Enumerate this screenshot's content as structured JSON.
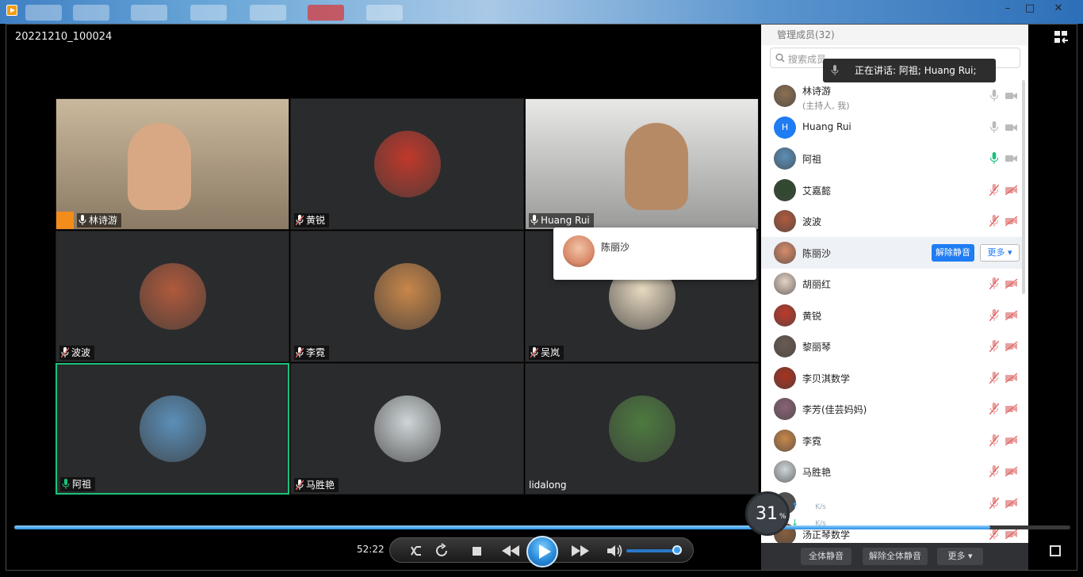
{
  "window": {
    "title": "20221210_100024",
    "controls": [
      "–",
      "□",
      "✕"
    ]
  },
  "video_tiles": [
    {
      "name": "林诗游",
      "mic": "on",
      "host": true,
      "avatar_color": "#8c6f52"
    },
    {
      "name": "黄锐",
      "mic": "muted",
      "host": false,
      "avatar_color": "#c0392b"
    },
    {
      "name": "Huang Rui",
      "mic": "on",
      "host": false,
      "avatar_color": "#6d6a66"
    },
    {
      "name": "波波",
      "mic": "muted",
      "host": false,
      "avatar_color": "#b05a3c"
    },
    {
      "name": "李霓",
      "mic": "muted",
      "host": false,
      "avatar_color": "#c9874a"
    },
    {
      "name": "吴岚",
      "mic": "muted",
      "host": false,
      "avatar_color": "#e7d9c0"
    },
    {
      "name": "阿祖",
      "mic": "speaking",
      "host": false,
      "avatar_color": "#5b8fb8",
      "active": true
    },
    {
      "name": "马胜艳",
      "mic": "muted",
      "host": false,
      "avatar_color": "#cfd6d8"
    },
    {
      "name": "lidalong",
      "mic": "none",
      "host": false,
      "avatar_color": "#4d7a3f"
    }
  ],
  "popup": {
    "name": "陈丽沙"
  },
  "panel": {
    "title": "管理成员(32)",
    "search_placeholder": "搜索成员",
    "speaking_label": "正在讲话: 阿祖; Huang Rui;",
    "unmute_label": "解除静音",
    "more_label": "更多 ▾",
    "members": [
      {
        "name": "林诗游",
        "sub": "(主持人, 我)",
        "mic": "on",
        "avatar_color": "#8c6f52"
      },
      {
        "name": "Huang Rui",
        "mic": "on",
        "avatar_color": "#1f7cf2",
        "initial": "H"
      },
      {
        "name": "阿祖",
        "mic": "speaking",
        "avatar_color": "#5b8fb8"
      },
      {
        "name": "艾嘉懿",
        "mic": "muted",
        "avatar_color": "#2e4a2c"
      },
      {
        "name": "波波",
        "mic": "muted",
        "avatar_color": "#b05a3c"
      },
      {
        "name": "陈丽沙",
        "mic": "muted",
        "avatar_color": "#d98b6a",
        "highlight": true
      },
      {
        "name": "胡丽红",
        "mic": "muted",
        "avatar_color": "#e5d2c4"
      },
      {
        "name": "黄锐",
        "mic": "muted",
        "avatar_color": "#c0392b"
      },
      {
        "name": "黎丽琴",
        "mic": "muted",
        "avatar_color": "#6a5a52"
      },
      {
        "name": "李贝淇数学",
        "mic": "muted",
        "avatar_color": "#a8321f"
      },
      {
        "name": "李芳(佳芸妈妈)",
        "mic": "muted",
        "avatar_color": "#8a6276"
      },
      {
        "name": "李霓",
        "mic": "muted",
        "avatar_color": "#c9874a"
      },
      {
        "name": "马胜艳",
        "mic": "muted",
        "avatar_color": "#cfd6d8"
      },
      {
        "name": "",
        "mic": "muted",
        "avatar_color": "#555555"
      },
      {
        "name": "汤正琴数学",
        "mic": "muted",
        "avatar_color": "#8b5e3c"
      }
    ],
    "footer": [
      "全体静音",
      "解除全体静音",
      "更多 ▾"
    ]
  },
  "player": {
    "elapsed": "52:22",
    "progress": 0.924,
    "volume": 0.9,
    "speed_percent": "31",
    "speed_unit": "%",
    "upload_rate": "3.2",
    "download_rate": "0.2",
    "rate_unit": "K/s"
  },
  "colors": {
    "accent": "#1f7cf2",
    "speaking": "#1ac27a",
    "muted": "#e06060",
    "tile_bg": "#2a2b2d"
  }
}
